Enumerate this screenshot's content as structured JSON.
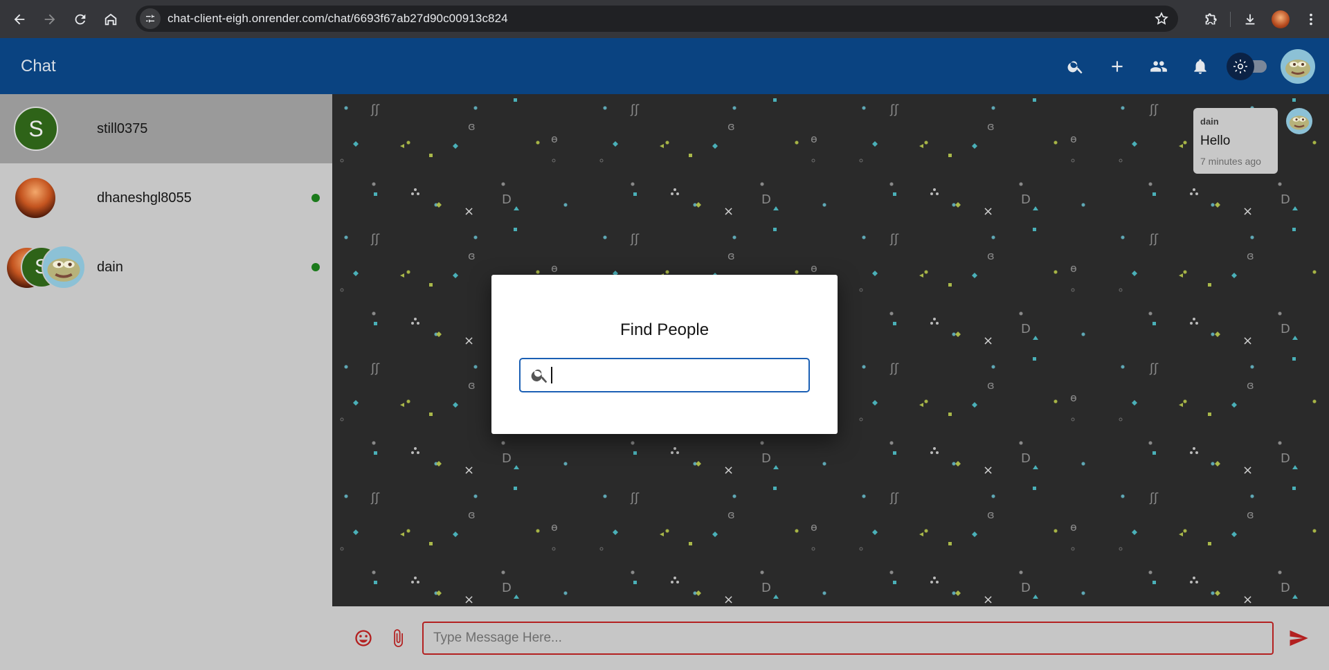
{
  "browser": {
    "url": "chat-client-eigh.onrender.com/chat/6693f67ab27d90c00913c824",
    "icons": [
      "back-icon",
      "forward-icon",
      "reload-icon",
      "home-icon",
      "site-info-icon",
      "star-icon",
      "extensions-icon",
      "download-icon",
      "menu-icon"
    ]
  },
  "header": {
    "title": "Chat",
    "actions": [
      "search-icon",
      "add-icon",
      "groups-icon",
      "notifications-icon",
      "theme-toggle",
      "avatar"
    ]
  },
  "sidebar": {
    "contacts": [
      {
        "name": "still0375",
        "initial": "S",
        "online": false,
        "active": true
      },
      {
        "name": "dhaneshgl8055",
        "initial": "",
        "online": true,
        "active": false
      },
      {
        "name": "dain",
        "initial": "S",
        "online": true,
        "active": false
      }
    ]
  },
  "messages": [
    {
      "sender": "dain",
      "text": "Hello",
      "time": "7 minutes ago"
    }
  ],
  "composer": {
    "placeholder": "Type Message Here..."
  },
  "modal": {
    "title": "Find People",
    "search_value": ""
  },
  "colors": {
    "header_bg": "#0a4381",
    "accent_red": "#b32020",
    "online": "#1b7a1b",
    "sidebar_bg": "#c6c6c6",
    "chat_bg": "#2a2a2a"
  }
}
